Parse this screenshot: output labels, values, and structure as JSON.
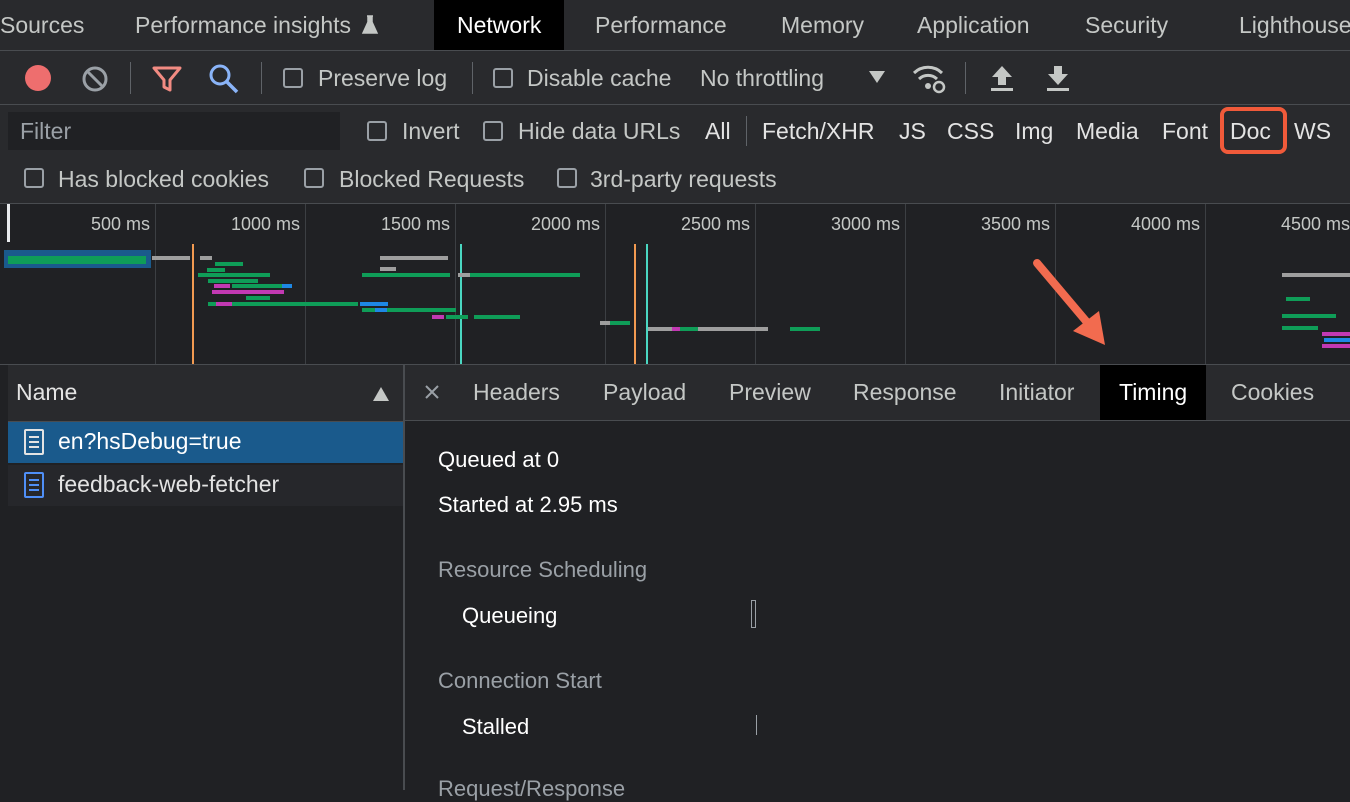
{
  "top_tabs": [
    "Sources",
    "Performance insights",
    "Network",
    "Performance",
    "Memory",
    "Application",
    "Security",
    "Lighthouse"
  ],
  "toolbar": {
    "preserve_log": "Preserve log",
    "disable_cache": "Disable cache",
    "throttling": "No throttling"
  },
  "filter": {
    "placeholder": "Filter",
    "invert": "Invert",
    "hide_data_urls": "Hide data URLs",
    "types": [
      "All",
      "Fetch/XHR",
      "JS",
      "CSS",
      "Img",
      "Media",
      "Font",
      "Doc",
      "WS"
    ],
    "has_blocked_cookies": "Has blocked cookies",
    "blocked_requests": "Blocked Requests",
    "third_party": "3rd-party requests"
  },
  "overview": {
    "ticks": [
      "500 ms",
      "1000 ms",
      "1500 ms",
      "2000 ms",
      "2500 ms",
      "3000 ms",
      "3500 ms",
      "4000 ms",
      "4500 ms"
    ]
  },
  "name_panel": {
    "header": "Name",
    "rows": [
      "en?hsDebug=true",
      "feedback-web-fetcher"
    ]
  },
  "detail_tabs": [
    "Headers",
    "Payload",
    "Preview",
    "Response",
    "Initiator",
    "Timing",
    "Cookies"
  ],
  "timing": {
    "queued": "Queued at 0",
    "started": "Started at 2.95 ms",
    "resource_scheduling": "Resource Scheduling",
    "queueing": "Queueing",
    "connection_start": "Connection Start",
    "stalled": "Stalled",
    "request_response": "Request/Response"
  },
  "colors": {
    "highlight_box": "#f05a3a",
    "arrow": "#f26b4f",
    "selected_row": "#1a5a8c",
    "green_bar": "#0f9d58"
  },
  "icons": [
    "record-icon",
    "clear-icon",
    "filter-icon",
    "search-icon",
    "dropdown-arrow-icon",
    "network-conditions-icon",
    "import-har-icon",
    "export-har-icon",
    "sort-ascending-icon",
    "close-icon",
    "document-icon"
  ]
}
